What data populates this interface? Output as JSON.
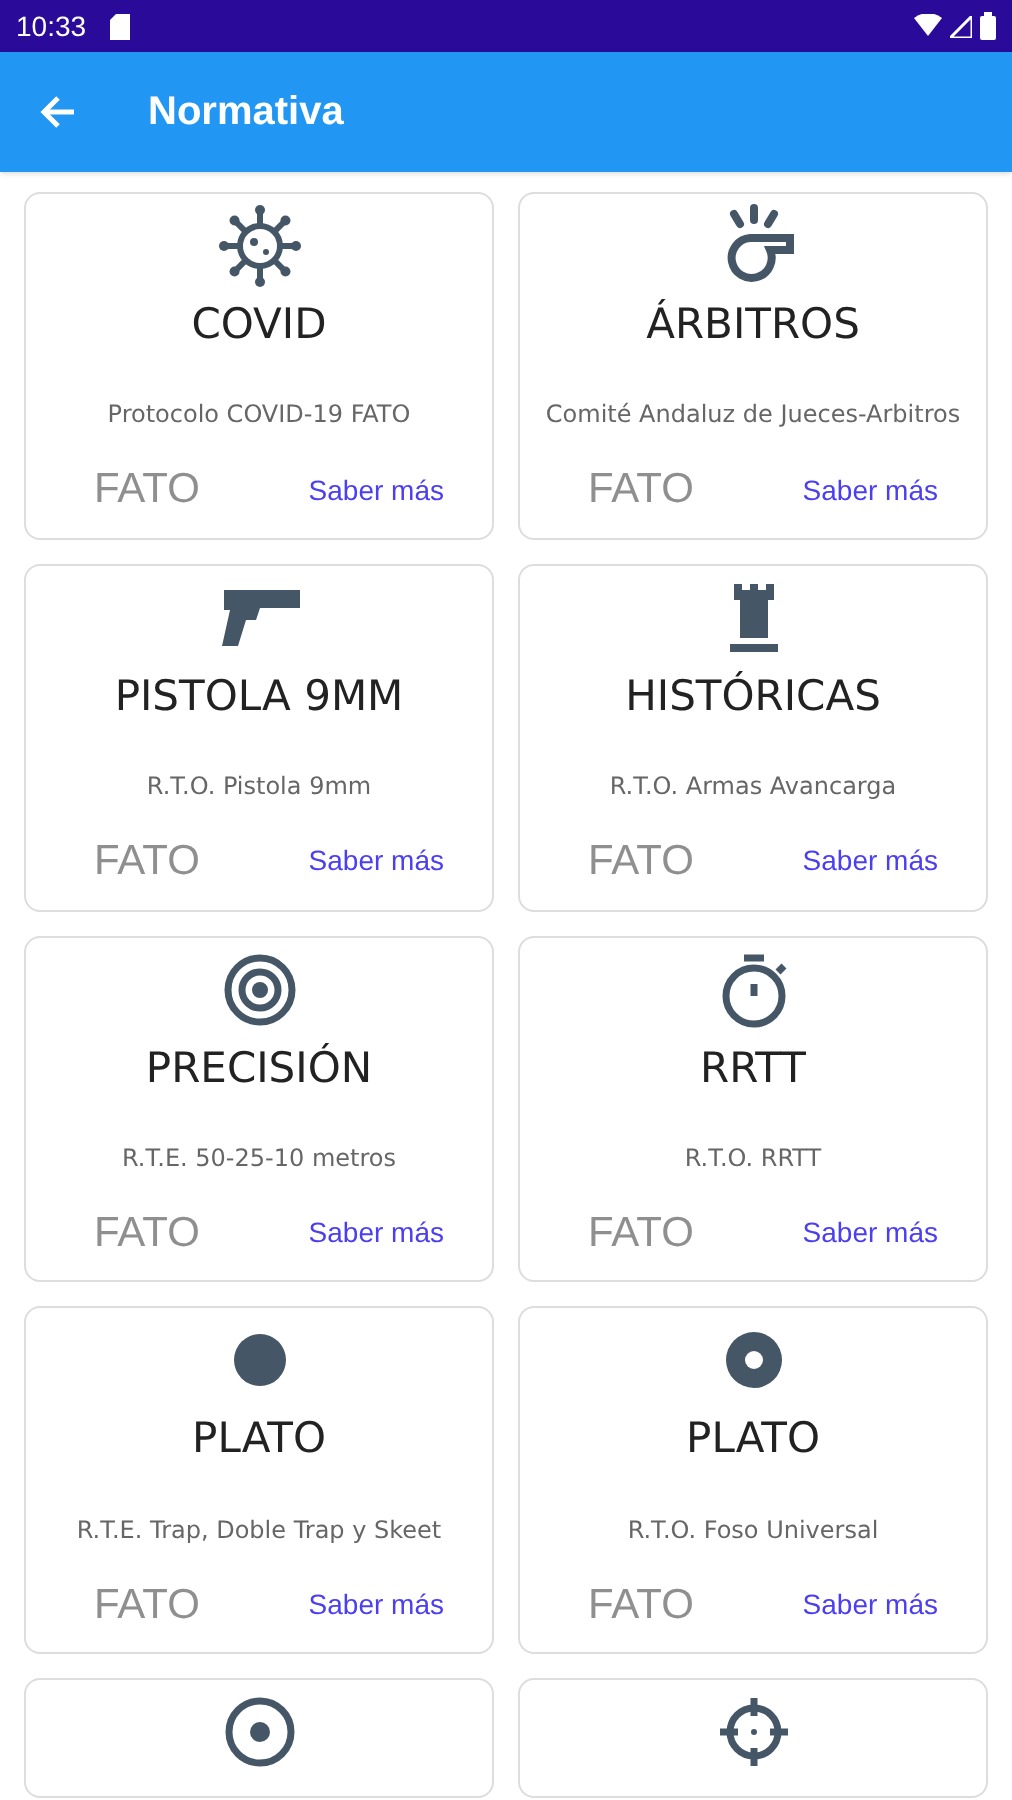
{
  "status_bar": {
    "time": "10:33"
  },
  "app_bar": {
    "title": "Normativa"
  },
  "cards": [
    {
      "title": "COVID",
      "description": "Protocolo COVID-19 FATO",
      "brand": "FATO",
      "link": "Saber más"
    },
    {
      "title": "ÁRBITROS",
      "description": "Comité Andaluz de Jueces-Arbitros",
      "brand": "FATO",
      "link": "Saber más"
    },
    {
      "title": "PISTOLA 9MM",
      "description": "R.T.O. Pistola 9mm",
      "brand": "FATO",
      "link": "Saber más"
    },
    {
      "title": "HISTÓRICAS",
      "description": "R.T.O. Armas Avancarga",
      "brand": "FATO",
      "link": "Saber más"
    },
    {
      "title": "PRECISIÓN",
      "description": "R.T.E. 50-25-10 metros",
      "brand": "FATO",
      "link": "Saber más"
    },
    {
      "title": "RRTT",
      "description": "R.T.O. RRTT",
      "brand": "FATO",
      "link": "Saber más"
    },
    {
      "title": "PLATO",
      "description": "R.T.E. Trap, Doble Trap y Skeet",
      "brand": "FATO",
      "link": "Saber más"
    },
    {
      "title": "PLATO",
      "description": "R.T.O. Foso Universal",
      "brand": "FATO",
      "link": "Saber más"
    },
    {
      "kind": "icon_only"
    },
    {
      "kind": "icon_only"
    }
  ]
}
